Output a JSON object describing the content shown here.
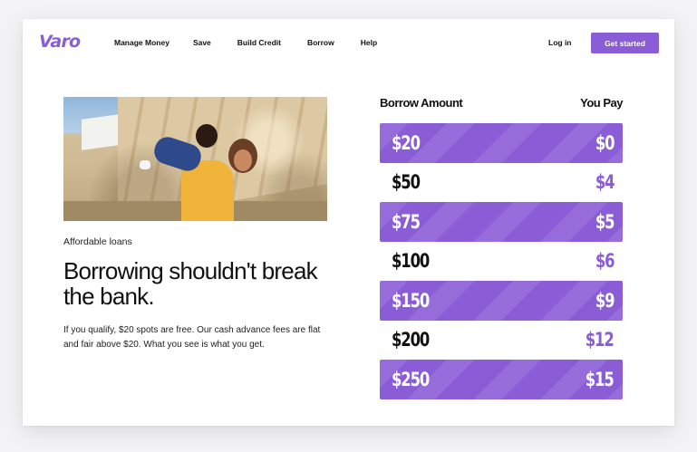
{
  "brand": {
    "name": "Varo",
    "accent": "#8a5cd6"
  },
  "nav": {
    "links": [
      "Manage Money",
      "Save",
      "Build Credit",
      "Borrow",
      "Help"
    ],
    "login": "Log in",
    "cta": "Get started"
  },
  "hero": {
    "eyebrow": "Affordable loans",
    "headline": "Borrowing shouldn't break the bank.",
    "body": "If you qualify, $20 spots are free.  Our cash advance fees are flat and fair above $20. What you see is what you get."
  },
  "pricing": {
    "columns": [
      "Borrow Amount",
      "You Pay"
    ],
    "rows": [
      {
        "amount": "$20",
        "pay": "$0"
      },
      {
        "amount": "$50",
        "pay": "$4"
      },
      {
        "amount": "$75",
        "pay": "$5"
      },
      {
        "amount": "$100",
        "pay": "$6"
      },
      {
        "amount": "$150",
        "pay": "$9"
      },
      {
        "amount": "$200",
        "pay": "$12"
      },
      {
        "amount": "$250",
        "pay": "$15"
      }
    ]
  }
}
